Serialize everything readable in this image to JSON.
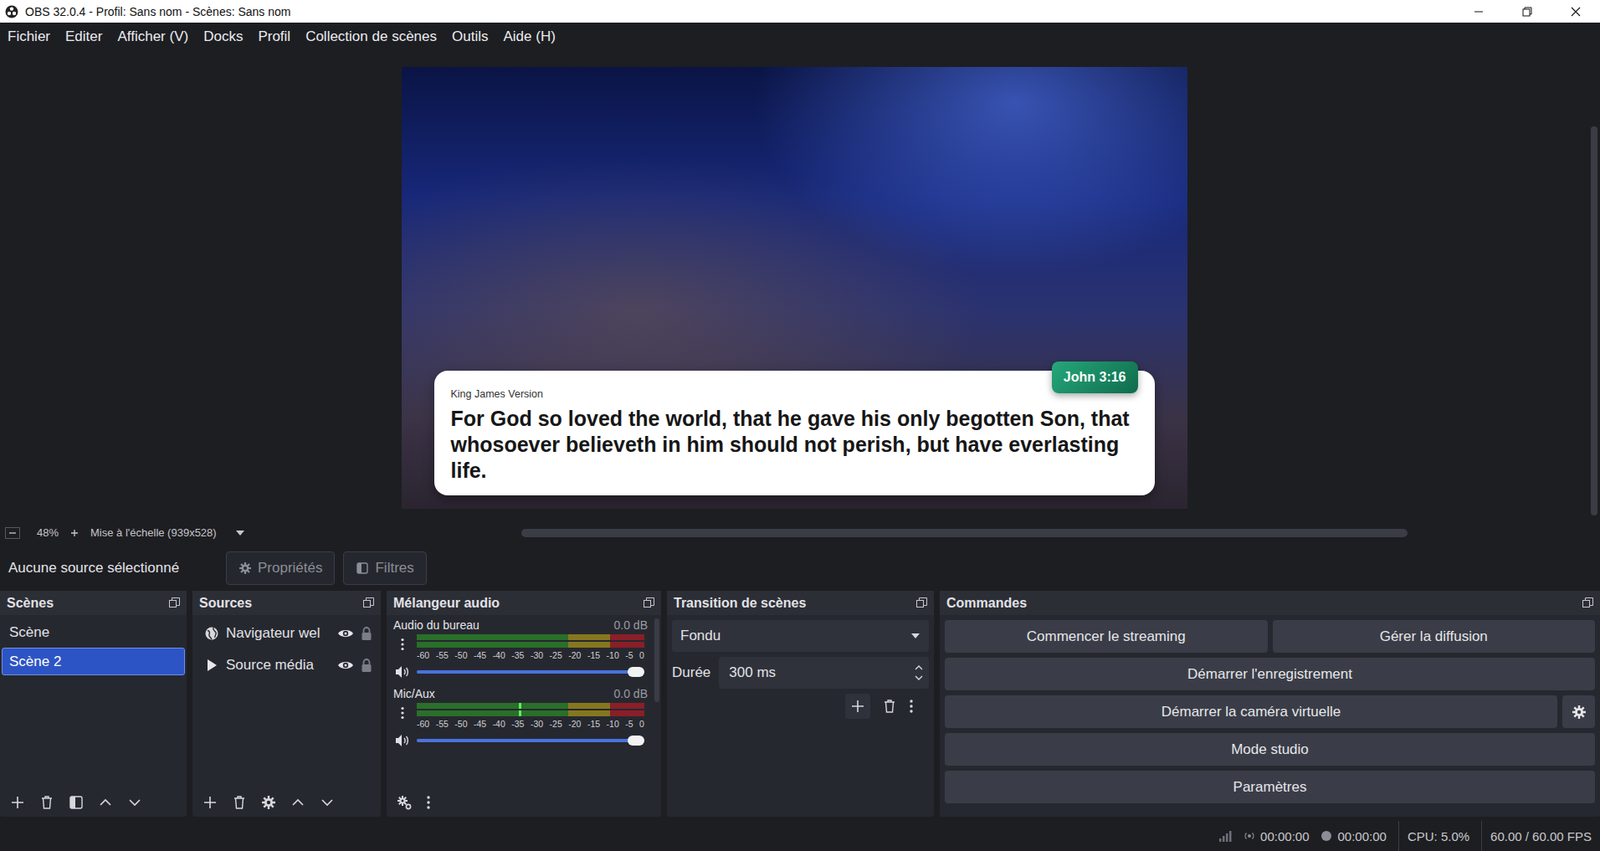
{
  "window": {
    "title": "OBS 32.0.4 - Profil: Sans nom - Scènes: Sans nom"
  },
  "menu": [
    "Fichier",
    "Editer",
    "Afficher (V)",
    "Docks",
    "Profil",
    "Collection de scènes",
    "Outils",
    "Aide (H)"
  ],
  "preview": {
    "overlay": {
      "version": "King James Version",
      "verse": "For God so loved the world, that he gave his only begotten Son, that whosoever believeth in him should not perish, but have everlasting life.",
      "reference": "John 3:16"
    }
  },
  "zoom_bar": {
    "zoom": "48%",
    "scale_mode": "Mise à l'échelle (939x528)"
  },
  "context_bar": {
    "label": "Aucune source sélectionné",
    "buttons": [
      {
        "label": "Propriétés",
        "kind": "properties",
        "disabled": true
      },
      {
        "label": "Filtres",
        "kind": "filters",
        "disabled": true
      }
    ]
  },
  "scenes": {
    "title": "Scènes",
    "items": [
      {
        "label": "Scène",
        "selected": false
      },
      {
        "label": "Scène 2",
        "selected": true
      }
    ]
  },
  "sources": {
    "title": "Sources",
    "items": [
      {
        "label": "Navigateur wel",
        "kind": "browser",
        "visible": true,
        "locked": false
      },
      {
        "label": "Source média",
        "kind": "media",
        "visible": true,
        "locked": false
      }
    ]
  },
  "mixer": {
    "title": "Mélangeur audio",
    "scale": [
      "-60",
      "-55",
      "-50",
      "-45",
      "-40",
      "-35",
      "-30",
      "-25",
      "-20",
      "-15",
      "-10",
      "-5",
      "0"
    ],
    "channels": [
      {
        "name": "Audio du bureau",
        "reading": "0.0 dB",
        "level": 0,
        "peak": 0,
        "volume": 1,
        "muted": false
      },
      {
        "name": "Mic/Aux",
        "reading": "0.0 dB",
        "level": 0,
        "peak": 0.45,
        "volume": 1,
        "muted": false
      }
    ]
  },
  "transition": {
    "title": "Transition de scènes",
    "selected": "Fondu",
    "duration_label": "Durée",
    "duration": "300 ms"
  },
  "commands": {
    "title": "Commandes",
    "rows": [
      {
        "kind": "pair",
        "buttons": [
          "Commencer le streaming",
          "Gérer la diffusion"
        ]
      },
      {
        "kind": "single",
        "buttons": [
          "Démarrer l'enregistrement"
        ]
      },
      {
        "kind": "with-settings",
        "buttons": [
          "Démarrer la caméra virtuelle"
        ]
      },
      {
        "kind": "single",
        "buttons": [
          "Mode studio"
        ]
      },
      {
        "kind": "single",
        "buttons": [
          "Paramètres"
        ]
      }
    ]
  },
  "status_bar": {
    "stream_time": "00:00:00",
    "record_time": "00:00:00",
    "cpu": "CPU: 5.0%",
    "fps": "60.00 / 60.00 FPS"
  }
}
